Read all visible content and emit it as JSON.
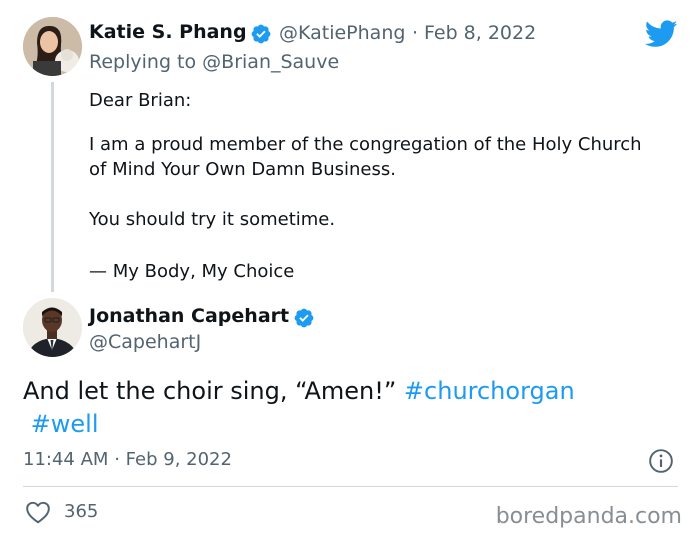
{
  "reply_tweet": {
    "name": "Katie S. Phang",
    "handle": "@KatiePhang",
    "separator": "·",
    "date": "Feb 8, 2022",
    "replying_prefix": "Replying to",
    "replying_to": "@Brian_Sauve",
    "lines": [
      "Dear Brian:",
      "I am a proud member of the congregation of the Holy Church",
      "of Mind Your Own Damn Business.",
      "You should try it sometime.",
      "— My Body, My Choice"
    ]
  },
  "main_tweet": {
    "name": "Jonathan Capehart",
    "handle": "@CapehartJ",
    "text": "And let the choir sing, “Amen!”",
    "hashtags": [
      "#churchorgan",
      "#well"
    ],
    "time": "11:44 AM",
    "separator": "·",
    "date": "Feb 9, 2022",
    "likes": "365"
  },
  "watermark": "boredpanda.com",
  "colors": {
    "accent": "#1d9bf0",
    "text": "#0f1419",
    "secondary": "#536471"
  },
  "icons": [
    "twitter-bird-icon",
    "verified-badge-icon",
    "info-icon",
    "heart-icon"
  ]
}
